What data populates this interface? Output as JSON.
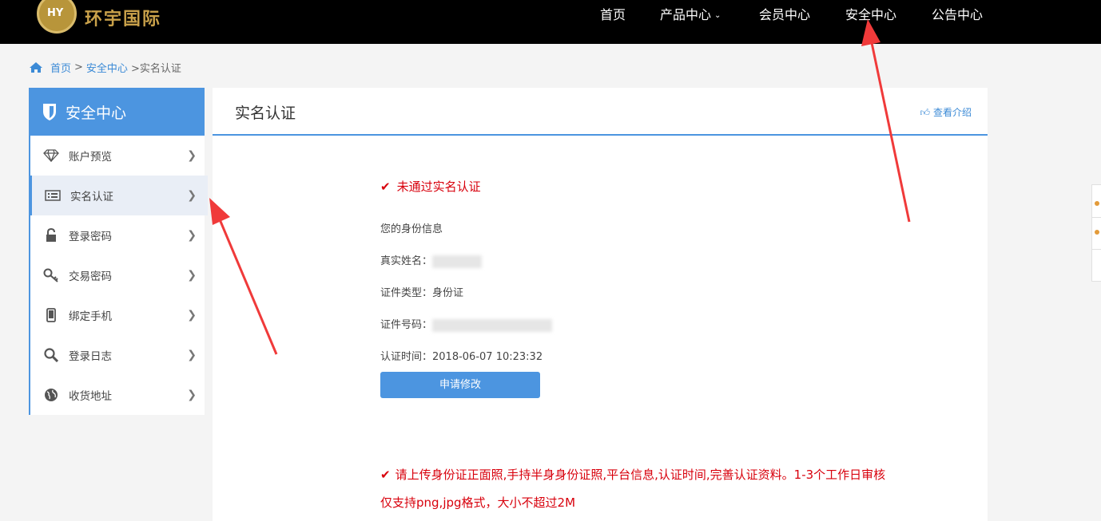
{
  "header": {
    "logo_mono": "HY",
    "brand": "环宇国际",
    "nav": [
      "首页",
      "产品中心",
      "会员中心",
      "安全中心",
      "公告中心"
    ]
  },
  "breadcrumb": {
    "home": "首页",
    "separator": ">",
    "security": "安全中心",
    "current": ">实名认证"
  },
  "sidebar": {
    "title": "安全中心",
    "items": [
      {
        "label": "账户预览",
        "icon": "diamond-icon"
      },
      {
        "label": "实名认证",
        "icon": "id-card-icon"
      },
      {
        "label": "登录密码",
        "icon": "lock-icon"
      },
      {
        "label": "交易密码",
        "icon": "key-icon"
      },
      {
        "label": "绑定手机",
        "icon": "phone-icon"
      },
      {
        "label": "登录日志",
        "icon": "search-icon"
      },
      {
        "label": "收货地址",
        "icon": "globe-icon"
      }
    ]
  },
  "main": {
    "title": "实名认证",
    "intro_link": "查看介绍",
    "status": "未通过实名认证",
    "identity_heading": "您的身份信息",
    "name_label": "真实姓名：",
    "type_label": "证件类型：",
    "type_value": "身份证",
    "number_label": "证件号码：",
    "time_label": "认证时间：",
    "time_value": "2018-06-07 10:23:32",
    "apply_button": "申请修改",
    "notice_line1": "请上传身份证正面照,手持半身身份证照,平台信息,认证时间,完善认证资料。1-3个工作日审核",
    "notice_line2": "仅支持png,jpg格式，大小不超过2M"
  },
  "colors": {
    "accent": "#4c95e0",
    "warning_red": "#d8000c",
    "brand_gold": "#c9a14a",
    "arrow_red": "#f03a3a"
  }
}
